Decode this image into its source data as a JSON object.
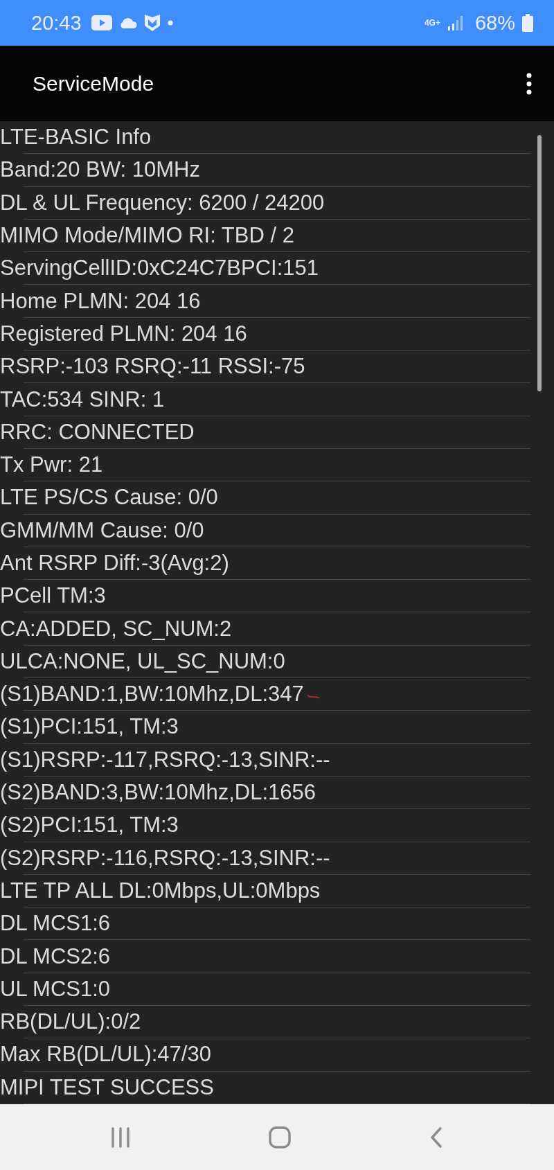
{
  "status_bar": {
    "time": "20:43",
    "network": "4G+",
    "battery": "68%"
  },
  "app_bar": {
    "title": "ServiceMode"
  },
  "rows": [
    {
      "text": "LTE-BASIC Info"
    },
    {
      "text": "Band:20 BW: 10MHz"
    },
    {
      "text": "DL & UL Frequency: 6200 / 24200"
    },
    {
      "text": "MIMO Mode/MIMO RI: TBD / 2"
    },
    {
      "text": "ServingCellID:0xC24C7BPCI:151"
    },
    {
      "text": "Home PLMN: 204 16"
    },
    {
      "text": "Registered PLMN: 204 16"
    },
    {
      "text": "RSRP:-103 RSRQ:-11 RSSI:-75"
    },
    {
      "text": "TAC:534 SINR: 1"
    },
    {
      "text": "RRC: CONNECTED"
    },
    {
      "text": "Tx Pwr: 21"
    },
    {
      "text": "LTE PS/CS Cause: 0/0"
    },
    {
      "text": "GMM/MM Cause: 0/0"
    },
    {
      "text": "Ant RSRP Diff:-3(Avg:2)"
    },
    {
      "text": "PCell TM:3"
    },
    {
      "text": "CA:ADDED, SC_NUM:2"
    },
    {
      "text": "ULCA:NONE, UL_SC_NUM:0"
    },
    {
      "text": "(S1)BAND:1,BW:10Mhz,DL:347",
      "kind": "marked"
    },
    {
      "text": "(S1)PCI:151, TM:3"
    },
    {
      "text": "(S1)RSRP:-117,RSRQ:-13,SINR:--"
    },
    {
      "text": "(S2)BAND:3,BW:10Mhz,DL:1656"
    },
    {
      "text": "(S2)PCI:151, TM:3"
    },
    {
      "text": "(S2)RSRP:-116,RSRQ:-13,SINR:--"
    },
    {
      "text": "LTE TP ALL DL:0Mbps,UL:0Mbps"
    },
    {
      "text": "DL MCS1:6"
    },
    {
      "text": "DL MCS2:6"
    },
    {
      "text": "UL MCS1:0"
    },
    {
      "text": "RB(DL/UL):0/2"
    },
    {
      "text": "Max RB(DL/UL):47/30"
    },
    {
      "text": "MIPI TEST SUCCESS"
    }
  ]
}
